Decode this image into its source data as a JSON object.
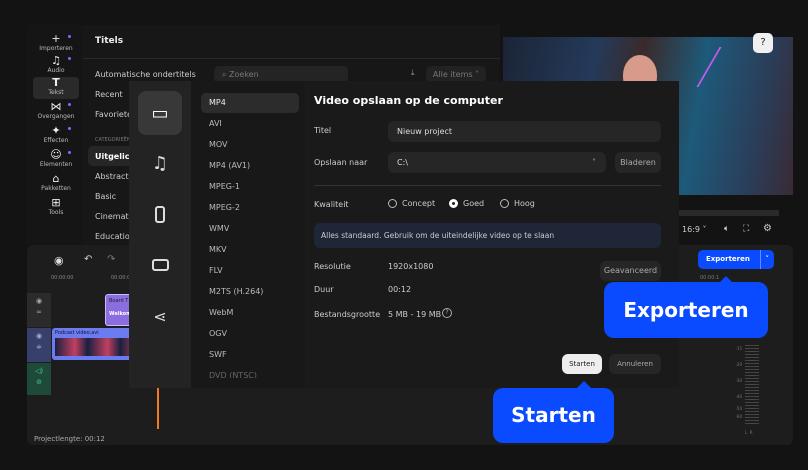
{
  "sidebar": {
    "items": [
      {
        "label": "Importeren",
        "icon": "plus-icon"
      },
      {
        "label": "Audio",
        "icon": "music-icon"
      },
      {
        "label": "Tekst",
        "icon": "text-icon"
      },
      {
        "label": "Overgangen",
        "icon": "transition-icon"
      },
      {
        "label": "Effecten",
        "icon": "sparkle-icon"
      },
      {
        "label": "Elementen",
        "icon": "smiley-icon"
      },
      {
        "label": "Pakketten",
        "icon": "package-icon"
      },
      {
        "label": "Tools",
        "icon": "tools-icon"
      }
    ]
  },
  "titles_panel": {
    "title": "Titels",
    "search_placeholder": "Zoeken",
    "filter": "Alle items",
    "items": [
      "Automatische ondertitels",
      "Recent",
      "Favorieten"
    ],
    "category_header": "CATEGORIEËN",
    "categories": [
      "Uitgelicht",
      "Abstract",
      "Basic",
      "Cinematic",
      "Education"
    ]
  },
  "preview": {
    "aspect": "16:9"
  },
  "export_button": {
    "label": "Exporteren"
  },
  "timeline": {
    "times": [
      "00:00:00",
      "00:00:0",
      "00:00:1"
    ],
    "clips": {
      "title_clip": "Board T",
      "title_sub": "Welkom",
      "video_clip": "Podcast video.avi"
    },
    "project_length": "Projectlengte: 00:12",
    "meter_ticks": [
      "-15",
      "-20",
      "-30",
      "-40",
      "-50",
      "-60"
    ],
    "channels": [
      "L",
      "R"
    ]
  },
  "dialog": {
    "formats": [
      "MP4",
      "AVI",
      "MOV",
      "MP4 (AV1)",
      "MPEG-1",
      "MPEG-2",
      "WMV",
      "MKV",
      "FLV",
      "M2TS (H.264)",
      "WebM",
      "OGV",
      "SWF",
      "DVD (NTSC)"
    ],
    "heading": "Video opslaan op de computer",
    "title_label": "Titel",
    "title_value": "Nieuw project",
    "save_label": "Opslaan naar",
    "save_value": "C:\\",
    "browse": "Bladeren",
    "quality_label": "Kwaliteit",
    "quality_options": [
      "Concept",
      "Goed",
      "Hoog"
    ],
    "quality_selected": "Goed",
    "info": "Alles standaard. Gebruik om de uiteindelijke video op te slaan",
    "resolution_label": "Resolutie",
    "resolution": "1920x1080",
    "duration_label": "Duur",
    "duration": "00:12",
    "size_label": "Bestandsgrootte",
    "size": "5 MB - 19 MB",
    "advanced": "Geavanceerd",
    "start": "Starten",
    "cancel": "Annuleren"
  },
  "callouts": {
    "export": "Exporteren",
    "start": "Starten"
  },
  "colors": {
    "accent": "#0a4bff",
    "title_clip": "#8a6ee0",
    "video_clip": "#6b7cf0",
    "audio_track": "#1f4a3a"
  }
}
